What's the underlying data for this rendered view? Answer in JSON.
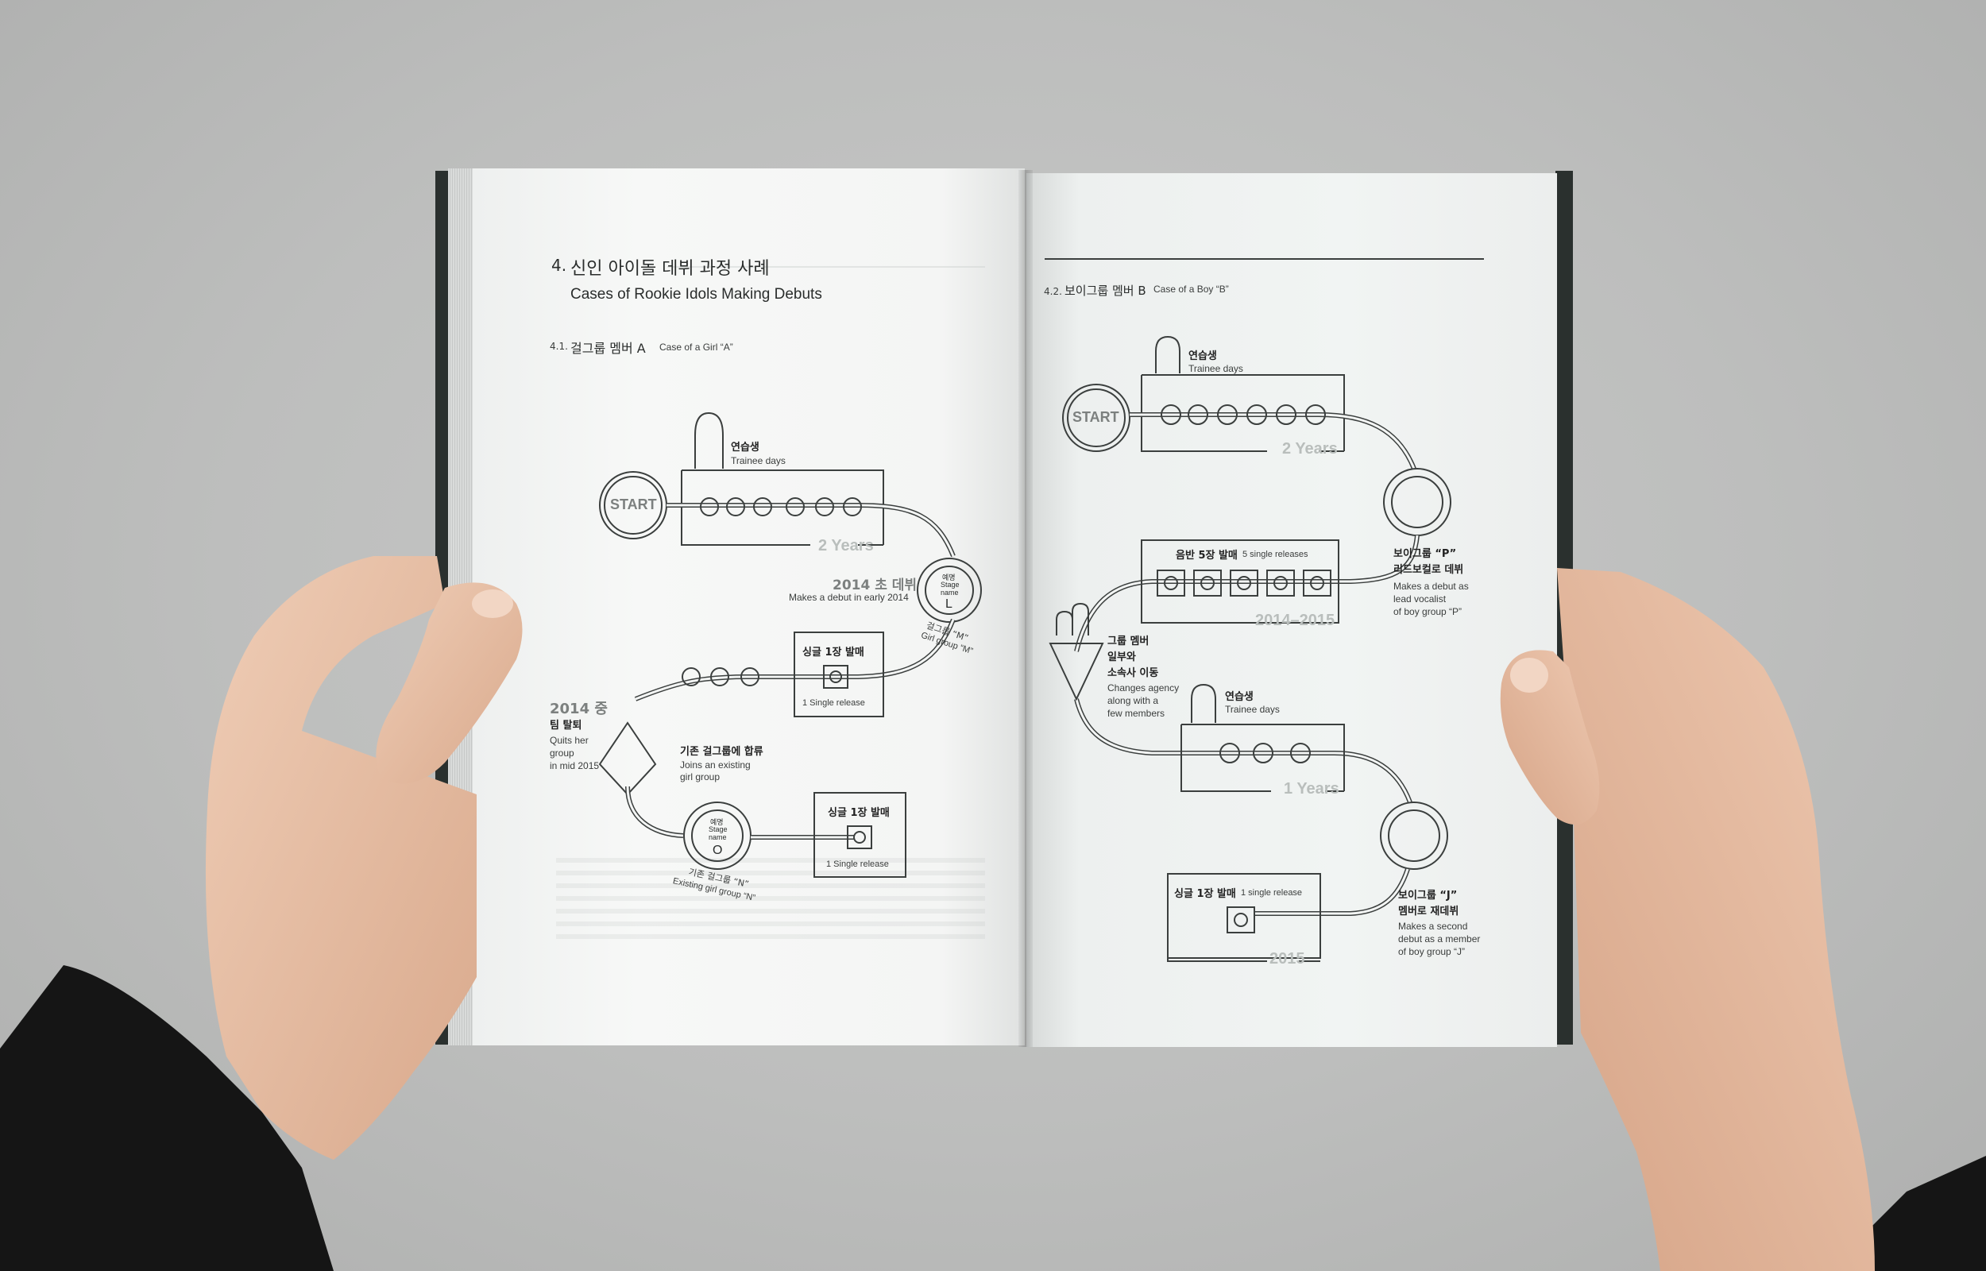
{
  "left_page": {
    "section_number": "4.",
    "title_kr": "신인 아이돌 데뷔 과정 사례",
    "title_en": "Cases of Rookie Idols Making Debuts",
    "subsection_number": "4.1.",
    "subsection_kr": "걸그룹 멤버 A",
    "subsection_en": "Case of a Girl “A”",
    "start": "START",
    "trainee_kr": "연습생",
    "trainee_en": "Trainee days",
    "years_1": "2 Years",
    "debut_year": "2014 초 데뷔",
    "debut_en": "Makes a debut in early 2014",
    "stage_name_kr": "예명",
    "stage_name_en_1": "Stage",
    "stage_name_en_2": "name",
    "letter_l": "L",
    "girl_group_m": "걸그룹 “M”",
    "girl_group_m_en": "Girl group “M”",
    "single_kr_1": "싱글 1장 발매",
    "single_en_1": "1 Single release",
    "quit_year": "2014 중",
    "quit_kr": "팀 탈퇴",
    "quit_en_1": "Quits her",
    "quit_en_2": "group",
    "quit_en_3": "in mid 2015",
    "join_kr": "기존 걸그룹에 합류",
    "join_en_1": "Joins an existing",
    "join_en_2": "girl group",
    "letter_o": "O",
    "existing_group_kr": "기존 걸그룹 “N”",
    "existing_group_en": "Existing girl group “N”",
    "single_kr_2": "싱글 1장 발매",
    "single_en_2": "1 Single release"
  },
  "right_page": {
    "subsection_number": "4.2.",
    "subsection_kr": "보이그룹 멤버 B",
    "subsection_en": "Case of a Boy “B”",
    "trainee_kr": "연습생",
    "trainee_en": "Trainee days",
    "start": "START",
    "years_1": "2 Years",
    "boy_group_p_kr_1": "보이그룹 “P”",
    "boy_group_p_kr_2": "리드보컬로 데뷔",
    "boy_group_p_en_1": "Makes a debut as",
    "boy_group_p_en_2": "lead vocalist",
    "boy_group_p_en_3": "of boy group “P”",
    "album_kr": "음반 5장 발매",
    "album_en": "5 single releases",
    "years_2": "2014–2015",
    "agency_kr_1": "그룹 멤버",
    "agency_kr_2": "일부와",
    "agency_kr_3": "소속사 이동",
    "agency_en_1": "Changes agency",
    "agency_en_2": "along with a",
    "agency_en_3": "few members",
    "trainee_kr_2": "연습생",
    "trainee_en_2": "Trainee days",
    "years_3": "1 Years",
    "single_kr": "싱글 1장 발매",
    "single_en": "1 single release",
    "years_4": "2015",
    "boy_group_j_kr_1": "보이그룹 “J”",
    "boy_group_j_kr_2": "멤버로 재데뷔",
    "boy_group_j_en_1": "Makes a second",
    "boy_group_j_en_2": "debut as a member",
    "boy_group_j_en_3": "of boy group “J”"
  },
  "colors": {
    "background": "#c2c3c2",
    "page": "#f3f5f4",
    "cover": "#2a302e",
    "skin": "#e8c1a8",
    "sleeve": "#1a1a1a",
    "line": "#3b3f3e"
  }
}
